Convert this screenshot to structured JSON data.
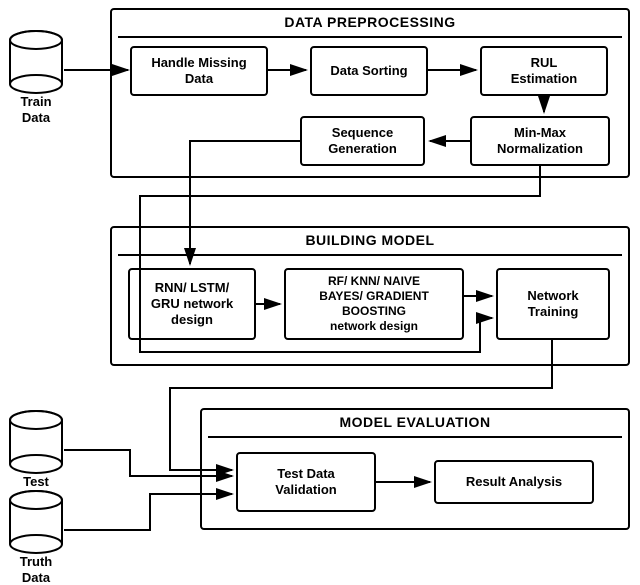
{
  "input_cylinders": {
    "train": "Train\nData",
    "test": "Test\nData",
    "truth": "Truth\nData"
  },
  "sections": {
    "preprocessing": {
      "title": "DATA PREPROCESSING",
      "handle_missing": "Handle Missing\nData",
      "data_sorting": "Data Sorting",
      "rul_estimation": "RUL\nEstimation",
      "sequence_generation": "Sequence\nGeneration",
      "minmax_norm": "Min-Max\nNormalization"
    },
    "building": {
      "title": "BUILDING MODEL",
      "nn_design": "RNN/ LSTM/\nGRU network\ndesign",
      "ml_design": "RF/ KNN/ NAIVE\nBAYES/ GRADIENT\nBOOSTING\nnetwork design",
      "training": "Network\nTraining"
    },
    "evaluation": {
      "title": "MODEL EVALUATION",
      "validation": "Test Data\nValidation",
      "analysis": "Result Analysis"
    }
  }
}
